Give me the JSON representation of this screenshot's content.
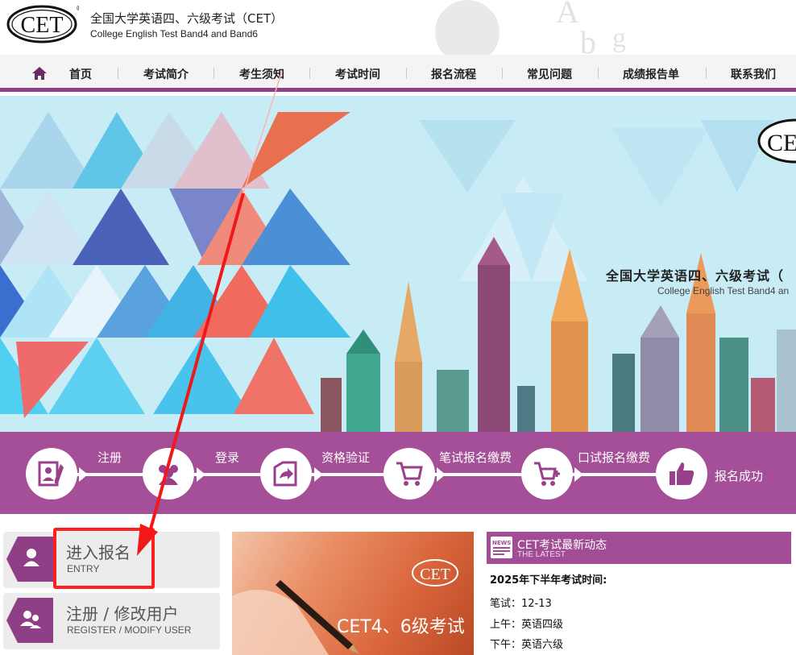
{
  "header": {
    "logo_text": "CET",
    "title": "全国大学英语四、六级考试（CET）",
    "subtitle": "College English Test Band4 and Band6"
  },
  "nav": {
    "items": [
      "首页",
      "考试简介",
      "考生须知",
      "考试时间",
      "报名流程",
      "常见问题",
      "成绩报告单",
      "联系我们"
    ]
  },
  "banner": {
    "logo_text": "CE",
    "title": "全国大学英语四、六级考试（",
    "subtitle": "College English Test Band4 an"
  },
  "steps": {
    "items": [
      "注册",
      "登录",
      "资格验证",
      "笔试报名缴费",
      "口试报名缴费",
      "报名成功"
    ]
  },
  "sidebar": {
    "items": [
      {
        "label": "进入报名",
        "sub": "ENTRY"
      },
      {
        "label": "注册 / 修改用户",
        "sub": "REGISTER / MODIFY USER"
      }
    ]
  },
  "promo": {
    "logo_text": "CET",
    "text": "CET4、6级考试"
  },
  "news": {
    "title": "CET考试最新动态",
    "subtitle": "THE LATEST",
    "icon_text": "NEWS",
    "heading": "2025年下半年考试时间:",
    "lines": [
      "笔试：12-13",
      "上午：英语四级",
      "下午：英语六级"
    ]
  },
  "colors": {
    "brand": "#a44f97",
    "nav_bar": "#8e3f86",
    "annotation": "#ff1f1f"
  }
}
